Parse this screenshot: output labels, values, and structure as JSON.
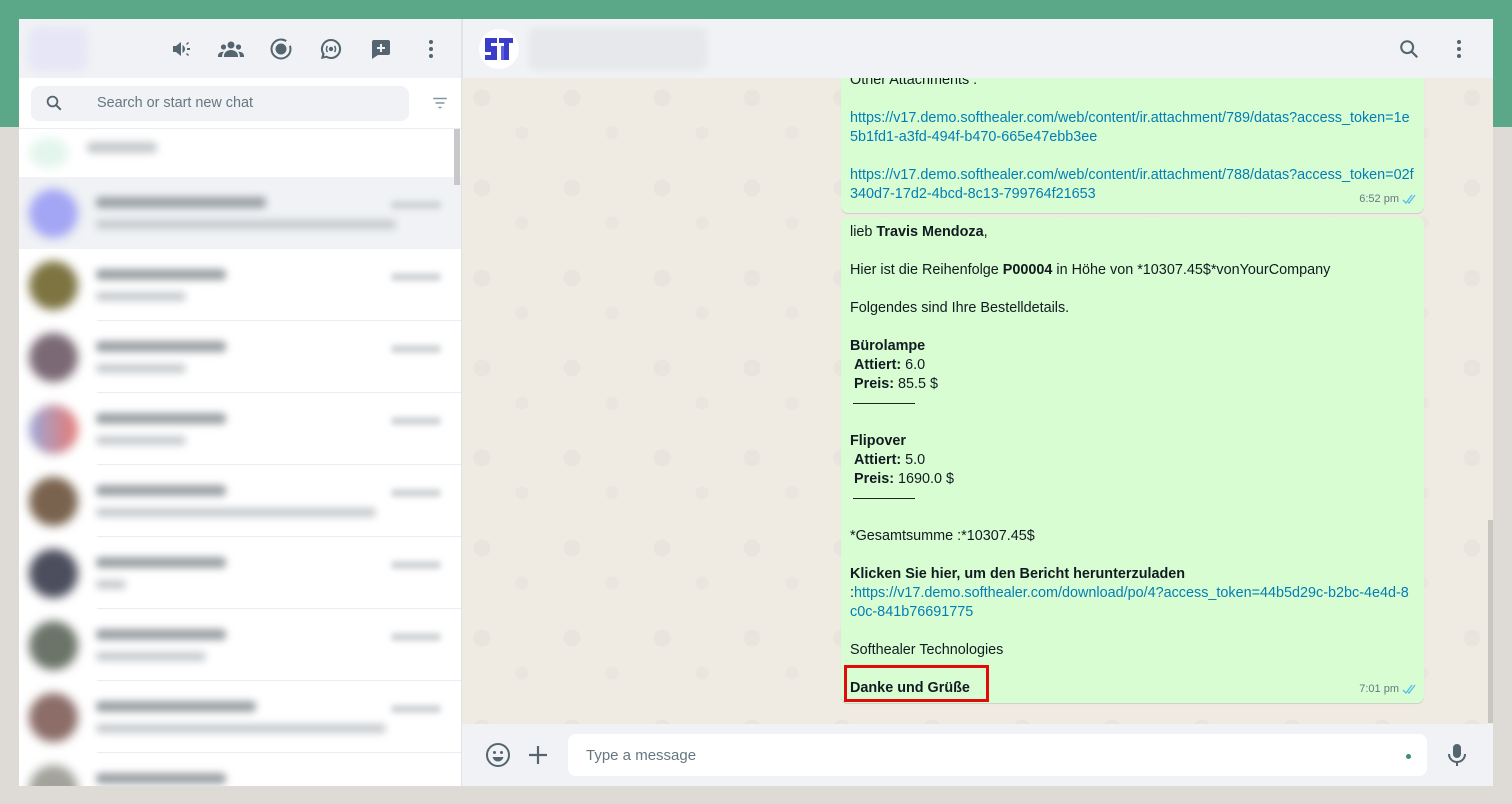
{
  "search": {
    "placeholder": "Search or start new chat"
  },
  "composer": {
    "placeholder": "Type a message"
  },
  "messages": [
    {
      "partial_top": "Other Attachments :",
      "links": [
        "https://v17.demo.softhealer.com/web/content/ir.attachment/789/datas?access_token=1e5b1fd1-a3fd-494f-b470-665e47ebb3ee",
        "https://v17.demo.softhealer.com/web/content/ir.attachment/788/datas?access_token=02f340d7-17d2-4bcd-8c13-799764f21653"
      ],
      "time": "6:52 pm"
    },
    {
      "greeting_prefix": "lieb ",
      "customer": "Travis Mendoza",
      "greeting_suffix": ",",
      "order_prefix": "Hier ist die Reihenfolge ",
      "order_ref": "P00004",
      "order_suffix": " in Höhe von  *10307.45$*vonYourCompany",
      "details_intro": "Folgendes sind Ihre Bestelldetails.",
      "items": [
        {
          "name": "Bürolampe",
          "qty_label": "Attiert:",
          "qty": " 6.0",
          "price_label": "Preis:",
          "price": " 85.5 $"
        },
        {
          "name": "Flipover",
          "qty_label": "Attiert:",
          "qty": " 5.0",
          "price_label": "Preis:",
          "price": " 1690.0 $"
        }
      ],
      "total": "*Gesamtsumme :*10307.45$",
      "download_label": "Klicken Sie hier, um den Bericht herunterzuladen",
      "download_colon": ":",
      "download_link": "https://v17.demo.softhealer.com/download/po/4?access_token=44b5d29c-b2bc-4e4d-8c0c-841b76691775",
      "company": "Softhealer Technologies",
      "closing": "Danke und Grüße",
      "time": "7:01 pm"
    }
  ],
  "colors": {
    "accent": "#00a884",
    "bubble": "#d9fdd3",
    "link": "#027eb5",
    "highlight": "#e10b0b",
    "read_ticks": "#53bdeb"
  },
  "icons": [
    "announcement-icon",
    "community-icon",
    "status-icon",
    "channels-icon",
    "new-chat-icon",
    "menu-icon",
    "search-icon",
    "filter-icon",
    "emoji-icon",
    "attach-icon",
    "mic-icon"
  ]
}
